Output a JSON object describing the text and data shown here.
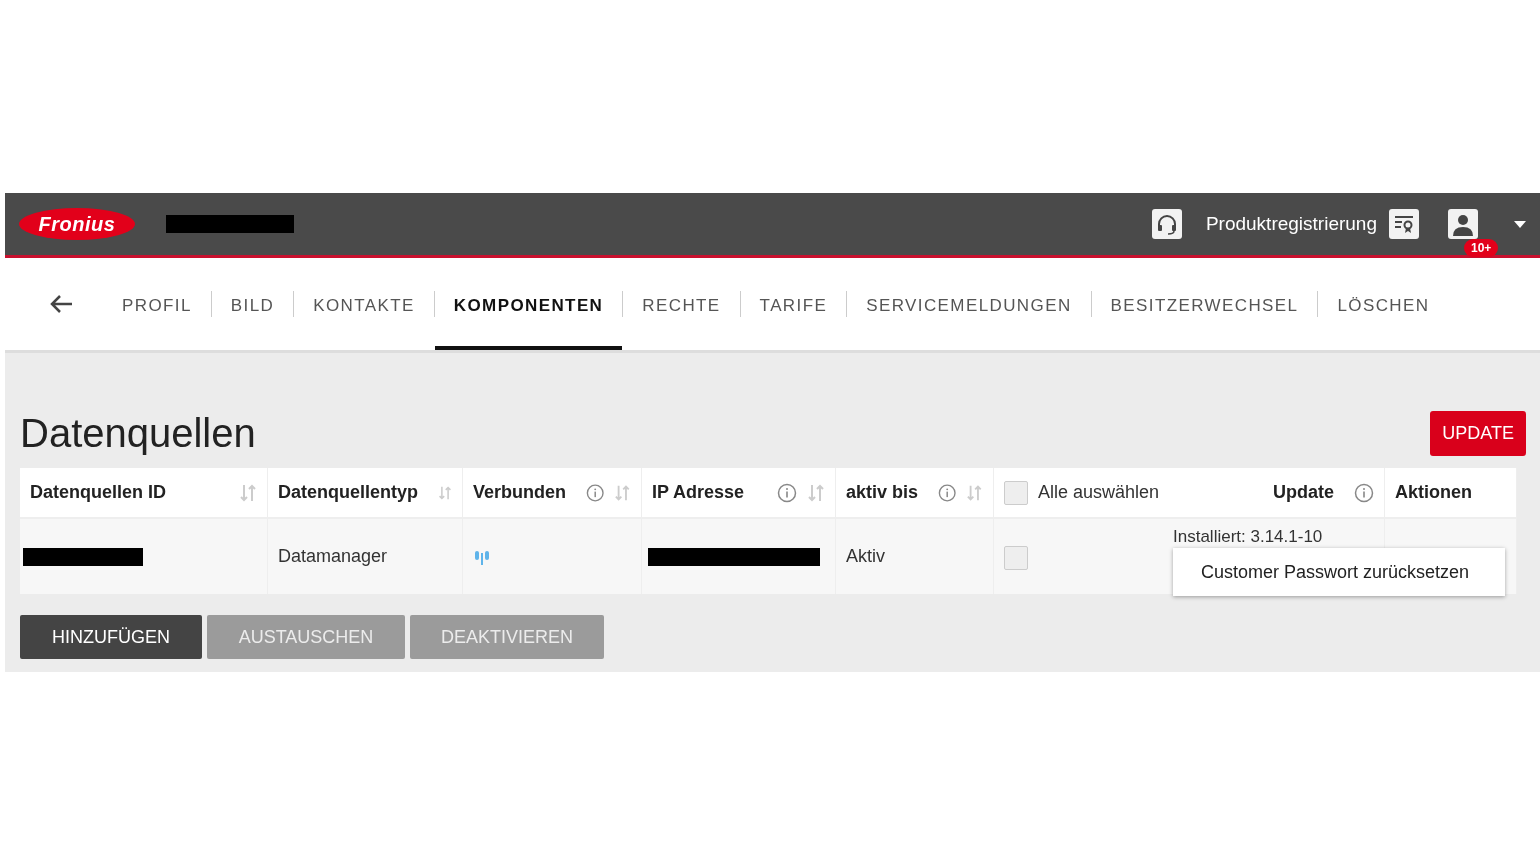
{
  "header": {
    "logo": "Fronius",
    "product_registration": "Produktregistrierung",
    "notification_badge": "10+"
  },
  "tabs": [
    {
      "label": "PROFIL",
      "selected": false
    },
    {
      "label": "BILD",
      "selected": false
    },
    {
      "label": "KONTAKTE",
      "selected": false
    },
    {
      "label": "KOMPONENTEN",
      "selected": true
    },
    {
      "label": "RECHTE",
      "selected": false
    },
    {
      "label": "TARIFE",
      "selected": false
    },
    {
      "label": "SERVICEMELDUNGEN",
      "selected": false
    },
    {
      "label": "BESITZERWECHSEL",
      "selected": false
    },
    {
      "label": "LÖSCHEN",
      "selected": false
    }
  ],
  "section": {
    "title": "Datenquellen",
    "update_button": "UPDATE"
  },
  "table": {
    "columns": [
      {
        "label": "Datenquellen ID",
        "info": false,
        "sortable": true
      },
      {
        "label": "Datenquellentyp",
        "info": false,
        "sortable": true
      },
      {
        "label": "Verbunden",
        "info": true,
        "sortable": true
      },
      {
        "label": "IP Adresse",
        "info": true,
        "sortable": true
      },
      {
        "label": "aktiv bis",
        "info": true,
        "sortable": true
      },
      {
        "label": "Update",
        "info": true,
        "sortable": false
      },
      {
        "label": "Aktionen",
        "info": false,
        "sortable": false
      }
    ],
    "select_all": {
      "label": "Alle auswählen",
      "checked": false
    },
    "rows": [
      {
        "type": "Datamanager",
        "connected": true,
        "active_until": "Aktiv",
        "checked": false,
        "update": "Installiert: 3.14.1-10"
      }
    ]
  },
  "context_menu": [
    "Customer Passwort zurücksetzen"
  ],
  "buttons": [
    {
      "label": "HINZUFÜGEN",
      "disabled": false
    },
    {
      "label": "AUSTAUSCHEN",
      "disabled": true
    },
    {
      "label": "DEAKTIVIEREN",
      "disabled": true
    }
  ]
}
